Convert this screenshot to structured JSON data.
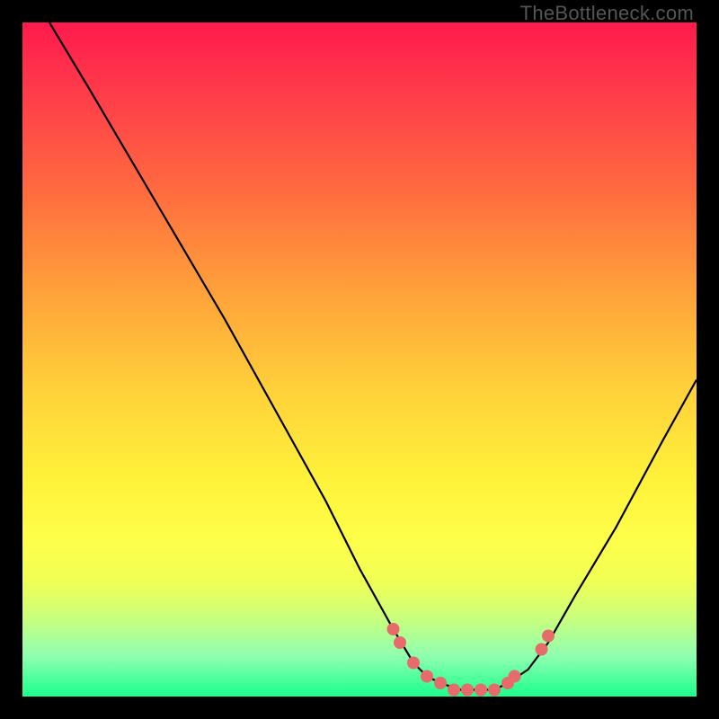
{
  "watermark": "TheBottleneck.com",
  "chart_data": {
    "type": "line",
    "title": "",
    "xlabel": "",
    "ylabel": "",
    "xlim": [
      0,
      100
    ],
    "ylim": [
      0,
      100
    ],
    "series": [
      {
        "name": "bottleneck-curve",
        "x": [
          4,
          10,
          20,
          30,
          40,
          45,
          50,
          55,
          58,
          60,
          62,
          65,
          68,
          70,
          72,
          75,
          78,
          82,
          88,
          95,
          100
        ],
        "y": [
          100,
          90,
          73,
          56,
          38,
          29,
          19,
          10,
          5,
          3,
          2,
          1,
          1,
          1,
          2,
          4,
          8,
          15,
          25,
          38,
          47
        ]
      },
      {
        "name": "markers",
        "type": "scatter",
        "x": [
          55,
          56,
          58,
          60,
          62,
          64,
          66,
          68,
          70,
          72,
          73,
          77,
          78
        ],
        "y": [
          10,
          8,
          5,
          3,
          2,
          1,
          1,
          1,
          1,
          2,
          3,
          7,
          9
        ]
      }
    ],
    "background_gradient": {
      "top": "#ff1a4d",
      "mid": "#fff23a",
      "bottom": "#1aff8c"
    }
  }
}
